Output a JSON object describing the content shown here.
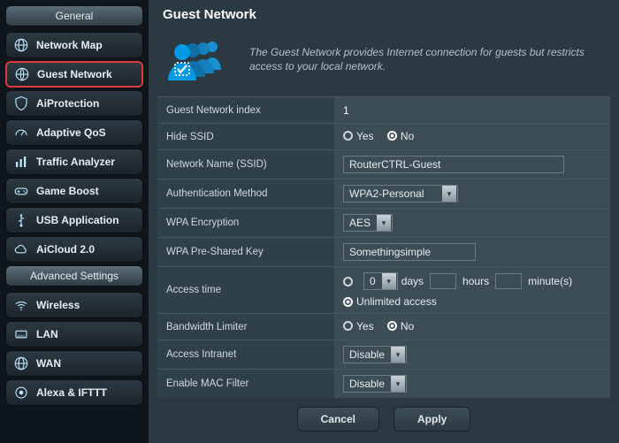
{
  "sidebar": {
    "group1": "General",
    "group2": "Advanced Settings",
    "items1": [
      {
        "label": "Network Map"
      },
      {
        "label": "Guest Network"
      },
      {
        "label": "AiProtection"
      },
      {
        "label": "Adaptive QoS"
      },
      {
        "label": "Traffic Analyzer"
      },
      {
        "label": "Game Boost"
      },
      {
        "label": "USB Application"
      },
      {
        "label": "AiCloud 2.0"
      }
    ],
    "items2": [
      {
        "label": "Wireless"
      },
      {
        "label": "LAN"
      },
      {
        "label": "WAN"
      },
      {
        "label": "Alexa & IFTTT"
      }
    ]
  },
  "page": {
    "title": "Guest Network",
    "heroText": "The Guest Network provides Internet connection for guests but restricts access to your local network."
  },
  "form": {
    "labels": {
      "index": "Guest Network index",
      "hideSsid": "Hide SSID",
      "ssid": "Network Name (SSID)",
      "auth": "Authentication Method",
      "enc": "WPA Encryption",
      "psk": "WPA Pre-Shared Key",
      "access": "Access time",
      "bw": "Bandwidth Limiter",
      "intranet": "Access Intranet",
      "mac": "Enable MAC Filter"
    },
    "yes": "Yes",
    "no": "No",
    "values": {
      "index": "1",
      "ssid": "RouterCTRL-Guest",
      "auth": "WPA2-Personal",
      "enc": "AES",
      "psk": "Somethingsimple",
      "accessDaysSel": "0",
      "daysLabel": "days",
      "hoursLabel": "hours",
      "minutesLabel": "minute(s)",
      "unlimited": "Unlimited access",
      "intranet": "Disable",
      "mac": "Disable"
    },
    "buttons": {
      "cancel": "Cancel",
      "apply": "Apply"
    }
  }
}
